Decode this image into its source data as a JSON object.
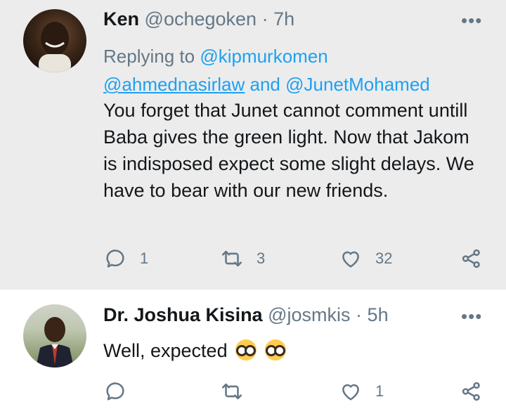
{
  "tweet1": {
    "name": "Ken",
    "handle": "@ochegoken",
    "sep": "·",
    "time": "7h",
    "more": "•••",
    "replying_prefix": "Replying to",
    "mention1": "@kipmurkomen",
    "mention2": "@ahmednasirlaw",
    "and_word": "and",
    "mention3": "@JunetMohamed",
    "text": "You forget that Junet cannot comment untill Baba gives the green light. Now that Jakom is indisposed expect some slight delays. We have to bear with our new friends.",
    "reply_count": "1",
    "retweet_count": "3",
    "like_count": "32"
  },
  "tweet2": {
    "name": "Dr. Joshua Kisina",
    "handle": "@josmkis",
    "sep": "·",
    "time": "5h",
    "more": "•••",
    "text": "Well, expected",
    "emojis": [
      "nerd-face",
      "nerd-face"
    ],
    "like_count": "1"
  },
  "colors": {
    "accent": "#1da1f2",
    "muted": "#657786",
    "thread_line": "#c4cfd6",
    "highlight_bg": "#ececec"
  }
}
